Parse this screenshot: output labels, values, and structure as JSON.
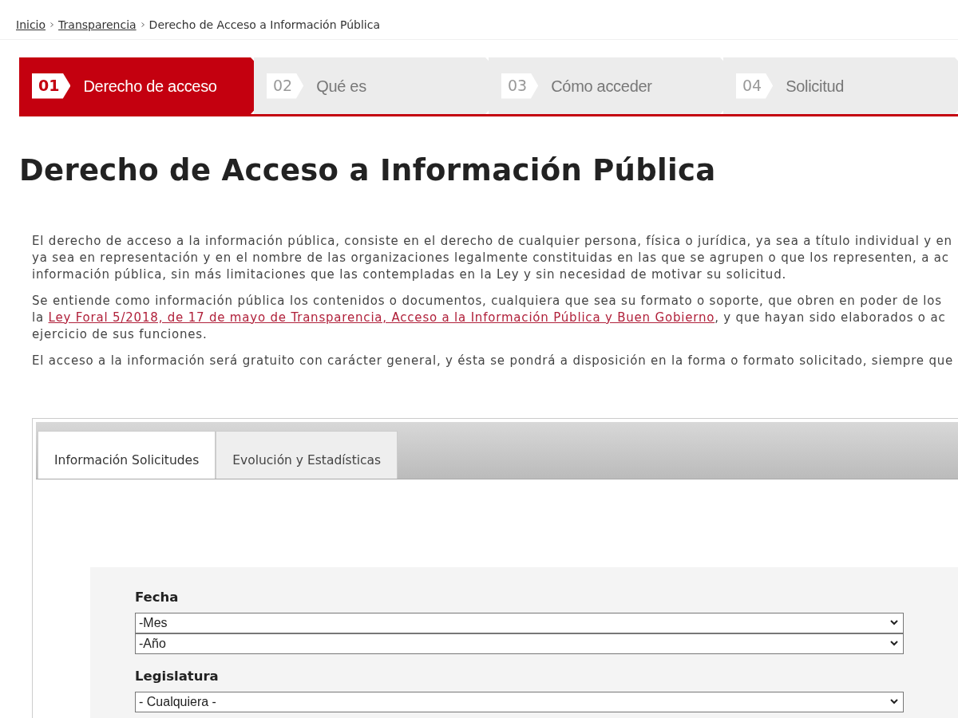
{
  "breadcrumb": [
    {
      "label": "Inicio",
      "kind": "link"
    },
    {
      "label": "Transparencia",
      "kind": "link"
    },
    {
      "label": "Derecho de Acceso a Información Pública",
      "kind": "current"
    }
  ],
  "steps": [
    {
      "number": "01",
      "label": "Derecho de acceso",
      "selected": true
    },
    {
      "number": "02",
      "label": "Qué es",
      "selected": false
    },
    {
      "number": "03",
      "label": "Cómo acceder",
      "selected": false
    },
    {
      "number": "04",
      "label": "Solicitud",
      "selected": false
    }
  ],
  "title": "Derecho de Acceso a Información Pública",
  "paragraphs": [
    [
      [
        {
          "kind": "text",
          "text": "El derecho de acceso a la información pública, consiste en el derecho de cualquier persona, física o jurídica, ya sea a título individual y en"
        }
      ],
      [
        {
          "kind": "text",
          "text": "ya sea en representación y en el nombre de las organizaciones legalmente constituidas en las que se agrupen o que los representen, a ac"
        }
      ],
      [
        {
          "kind": "text",
          "text": "información pública, sin más limitaciones que las contempladas en la Ley y sin necesidad de motivar su solicitud."
        }
      ]
    ],
    [
      [
        {
          "kind": "text",
          "text": "Se entiende como información pública los contenidos o documentos, cualquiera que sea su formato o soporte, que obren en poder de los"
        }
      ],
      [
        {
          "kind": "text",
          "text": "la "
        },
        {
          "kind": "link",
          "text": "Ley Foral 5/2018, de 17 de mayo de Transparencia, Acceso a la Información Pública y Buen Gobierno"
        },
        {
          "kind": "text",
          "text": ", y que hayan sido elaborados o ac"
        }
      ],
      [
        {
          "kind": "text",
          "text": "ejercicio de sus funciones."
        }
      ]
    ],
    [
      [
        {
          "kind": "text",
          "text": "El acceso a la información será gratuito con carácter general, y ésta se pondrá a disposición en la forma o formato solicitado, siempre que"
        }
      ]
    ]
  ],
  "tabs": [
    {
      "label": "Información Solicitudes",
      "selected": true
    },
    {
      "label": "Evolución y Estadísticas",
      "selected": false
    }
  ],
  "form": [
    {
      "label": "Fecha",
      "selects": [
        "-Mes",
        "-Año"
      ]
    },
    {
      "label": "Legislatura",
      "selects": [
        "- Cualquiera -"
      ]
    }
  ]
}
